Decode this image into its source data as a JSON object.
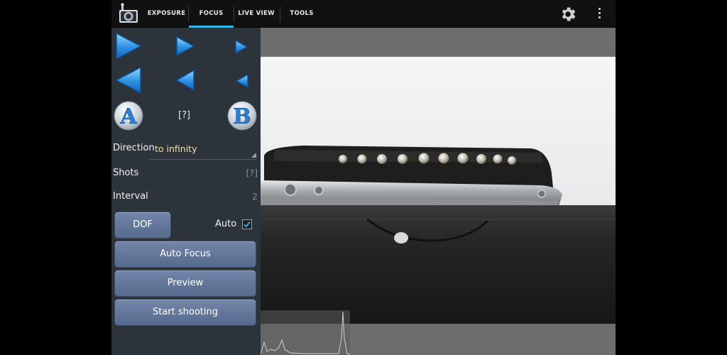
{
  "tabs": [
    {
      "label": "EXPOSURE",
      "selected": false
    },
    {
      "label": "FOCUS",
      "selected": true
    },
    {
      "label": "LIVE VIEW",
      "selected": false
    },
    {
      "label": "TOOLS",
      "selected": false
    }
  ],
  "focus_panel": {
    "step_help": "[?]",
    "button_a": "A",
    "button_b": "B",
    "direction_label": "Direction",
    "direction_value": "to infinity",
    "shots_label": "Shots",
    "shots_value": "[?]",
    "interval_label": "Interval",
    "interval_value": "2",
    "dof_label": "DOF",
    "auto_label": "Auto",
    "auto_checked": true,
    "autofocus_label": "Auto Focus",
    "preview_label": "Preview",
    "start_label": "Start shooting"
  },
  "colors": {
    "accent": "#33b5e5",
    "button": "#6779a0",
    "direction_text": "#f3e2a0"
  },
  "icons": [
    "camera-app-icon",
    "settings-gear-icon",
    "overflow-menu-icon",
    "arrow-icon",
    "histogram"
  ]
}
